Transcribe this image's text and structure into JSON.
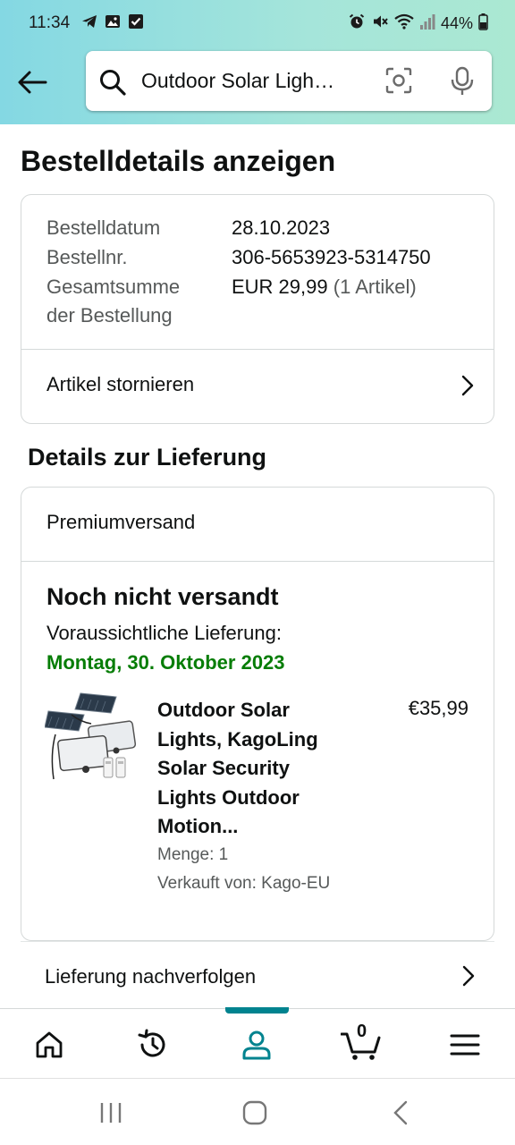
{
  "status_bar": {
    "time": "11:34",
    "battery": "44%"
  },
  "search": {
    "query": "Outdoor Solar Ligh…"
  },
  "page": {
    "title": "Bestelldetails anzeigen"
  },
  "order": {
    "date_label": "Bestelldatum",
    "date_value": "28.10.2023",
    "number_label": "Bestellnr.",
    "number_value": "306-5653923-5314750",
    "total_label_line1": "Gesamtsumme",
    "total_label_line2": "der Bestellung",
    "total_value": "EUR 29,99",
    "total_items": "(1 Artikel)",
    "cancel_label": "Artikel stornieren"
  },
  "delivery": {
    "section_title": "Details zur Lieferung",
    "shipping_type": "Premiumversand",
    "status": "Noch nicht versandt",
    "eta_label": "Voraussichtliche Lieferung:",
    "eta_date": "Montag, 30. Oktober 2023",
    "product": {
      "title_lines": [
        "Outdoor Solar",
        "Lights, KagoLing",
        "Solar Security",
        "Lights Outdoor",
        "Motion..."
      ],
      "price": "€35,99",
      "quantity": "Menge: 1",
      "seller": "Verkauft von: Kago-EU"
    },
    "track_label": "Lieferung nachverfolgen"
  },
  "bottom_nav": {
    "active": "account",
    "cart_count": "0",
    "accent_color": "#00838f"
  },
  "colors": {
    "delivery_date": "#067d06",
    "header_gradient_start": "#84d8e3",
    "header_gradient_end": "#abe8d2"
  }
}
